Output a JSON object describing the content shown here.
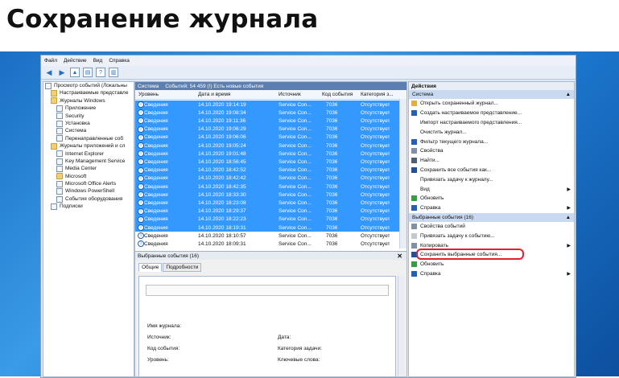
{
  "heading": "Сохранение журнала",
  "menu": [
    "Файл",
    "Действие",
    "Вид",
    "Справка"
  ],
  "tree": [
    {
      "label": "Просмотр событий (Локальны",
      "indent": 0,
      "icon": "computer-icon"
    },
    {
      "label": "Настраиваемые представле",
      "indent": 1,
      "icon": "folder-icon"
    },
    {
      "label": "Журналы Windows",
      "indent": 1,
      "icon": "folder-icon"
    },
    {
      "label": "Приложение",
      "indent": 2,
      "icon": "log-icon"
    },
    {
      "label": "Security",
      "indent": 2,
      "icon": "log-icon"
    },
    {
      "label": "Установка",
      "indent": 2,
      "icon": "log-icon"
    },
    {
      "label": "Система",
      "indent": 2,
      "icon": "log-icon"
    },
    {
      "label": "Перенаправленные соб",
      "indent": 2,
      "icon": "log-icon"
    },
    {
      "label": "Журналы приложений и сл",
      "indent": 1,
      "icon": "folder-icon"
    },
    {
      "label": "Internet Explorer",
      "indent": 2,
      "icon": "log-icon"
    },
    {
      "label": "Key Management Service",
      "indent": 2,
      "icon": "log-icon"
    },
    {
      "label": "Media Center",
      "indent": 2,
      "icon": "log-icon"
    },
    {
      "label": "Microsoft",
      "indent": 2,
      "icon": "folder-icon"
    },
    {
      "label": "Microsoft Office Alerts",
      "indent": 2,
      "icon": "log-icon"
    },
    {
      "label": "Windows PowerShell",
      "indent": 2,
      "icon": "log-icon"
    },
    {
      "label": "События оборудования",
      "indent": 2,
      "icon": "log-icon"
    },
    {
      "label": "Подписки",
      "indent": 1,
      "icon": "subscription-icon"
    }
  ],
  "center": {
    "title": "Система",
    "count": "Событий: 54 459 (!) Есть новые события",
    "columns": [
      "Уровень",
      "Дата и время",
      "Источник",
      "Код события",
      "Категория з..."
    ],
    "rows": [
      {
        "level": "Сведения",
        "date": "14.10.2020 19:14:19",
        "source": "Service Con...",
        "code": "7036",
        "cat": "Отсутствует",
        "sel": true
      },
      {
        "level": "Сведения",
        "date": "14.10.2020 19:08:34",
        "source": "Service Con...",
        "code": "7036",
        "cat": "Отсутствует",
        "sel": true
      },
      {
        "level": "Сведения",
        "date": "14.10.2020 19:11:36",
        "source": "Service Con...",
        "code": "7036",
        "cat": "Отсутствует",
        "sel": true
      },
      {
        "level": "Сведения",
        "date": "14.10.2020 19:06:29",
        "source": "Service Con...",
        "code": "7036",
        "cat": "Отсутствует",
        "sel": true
      },
      {
        "level": "Сведения",
        "date": "14.10.2020 19:06:06",
        "source": "Service Con...",
        "code": "7036",
        "cat": "Отсутствует",
        "sel": true
      },
      {
        "level": "Сведения",
        "date": "14.10.2020 19:05:24",
        "source": "Service Con...",
        "code": "7036",
        "cat": "Отсутствует",
        "sel": true
      },
      {
        "level": "Сведения",
        "date": "14.10.2020 19:01:48",
        "source": "Service Con...",
        "code": "7036",
        "cat": "Отсутствует",
        "sel": true
      },
      {
        "level": "Сведения",
        "date": "14.10.2020 18:56:45",
        "source": "Service Con...",
        "code": "7036",
        "cat": "Отсутствует",
        "sel": true
      },
      {
        "level": "Сведения",
        "date": "14.10.2020 18:42:52",
        "source": "Service Con...",
        "code": "7036",
        "cat": "Отсутствует",
        "sel": true
      },
      {
        "level": "Сведения",
        "date": "14.10.2020 18:42:42",
        "source": "Service Con...",
        "code": "7036",
        "cat": "Отсутствует",
        "sel": true
      },
      {
        "level": "Сведения",
        "date": "14.10.2020 18:42:35",
        "source": "Service Con...",
        "code": "7036",
        "cat": "Отсутствует",
        "sel": true
      },
      {
        "level": "Сведения",
        "date": "14.10.2020 18:33:30",
        "source": "Service Con...",
        "code": "7036",
        "cat": "Отсутствует",
        "sel": true
      },
      {
        "level": "Сведения",
        "date": "14.10.2020 18:23:08",
        "source": "Service Con...",
        "code": "7036",
        "cat": "Отсутствует",
        "sel": true
      },
      {
        "level": "Сведения",
        "date": "14.10.2020 18:29:37",
        "source": "Service Con...",
        "code": "7036",
        "cat": "Отсутствует",
        "sel": true
      },
      {
        "level": "Сведения",
        "date": "14.10.2020 18:22:23",
        "source": "Service Con...",
        "code": "7036",
        "cat": "Отсутствует",
        "sel": true
      },
      {
        "level": "Сведения",
        "date": "14.10.2020 18:19:31",
        "source": "Service Con...",
        "code": "7036",
        "cat": "Отсутствует",
        "sel": true
      },
      {
        "level": "Сведения",
        "date": "14.10.2020 18:10:57",
        "source": "Service Con...",
        "code": "7036",
        "cat": "Отсутствует",
        "sel": false
      },
      {
        "level": "Сведения",
        "date": "14.10.2020 18:09:31",
        "source": "Service Con...",
        "code": "7036",
        "cat": "Отсутствует",
        "sel": false
      }
    ]
  },
  "detail": {
    "title": "Выбранные события (16)",
    "tabs": [
      "Общие",
      "Подробности"
    ],
    "fields": {
      "log": "Имя журнала:",
      "source": "Источник:",
      "code": "Код события:",
      "level": "Уровень:",
      "date": "Дата:",
      "category": "Категория задачи:",
      "keywords": "Ключевые слова:"
    }
  },
  "actions": {
    "title": "Действия",
    "section1": "Система",
    "items1": [
      {
        "label": "Открыть сохраненный журнал...",
        "icon": "open-icon",
        "arrow": false
      },
      {
        "label": "Создать настраиваемое представление...",
        "icon": "filter-icon",
        "arrow": false
      },
      {
        "label": "Импорт настраиваемого представления...",
        "icon": "",
        "arrow": false
      },
      {
        "label": "Очистить журнал...",
        "icon": "",
        "arrow": false
      },
      {
        "label": "Фильтр текущего журнала...",
        "icon": "filter-icon",
        "arrow": false
      },
      {
        "label": "Свойства",
        "icon": "properties-icon",
        "arrow": false
      },
      {
        "label": "Найти...",
        "icon": "find-icon",
        "arrow": false
      },
      {
        "label": "Сохранить все события как...",
        "icon": "save-icon",
        "arrow": false
      },
      {
        "label": "Привязать задачу к журналу...",
        "icon": "",
        "arrow": false
      },
      {
        "label": "Вид",
        "icon": "",
        "arrow": true
      },
      {
        "label": "Обновить",
        "icon": "refresh-icon",
        "arrow": false
      },
      {
        "label": "Справка",
        "icon": "help-icon",
        "arrow": true
      }
    ],
    "section2": "Выбранные события (16)",
    "items2": [
      {
        "label": "Свойства событий",
        "icon": "properties-icon",
        "arrow": false
      },
      {
        "label": "Привязать задачу к событию...",
        "icon": "task-icon",
        "arrow": false
      },
      {
        "label": "Копировать",
        "icon": "copy-icon",
        "arrow": true
      },
      {
        "label": "Сохранить выбранные события...",
        "icon": "save-icon",
        "arrow": false
      },
      {
        "label": "Обновить",
        "icon": "refresh-icon",
        "arrow": false
      },
      {
        "label": "Справка",
        "icon": "help-icon",
        "arrow": true
      }
    ]
  },
  "colors": {
    "selection": "#3399ff",
    "highlight": "#e0202a",
    "section": "#c9daf0"
  }
}
